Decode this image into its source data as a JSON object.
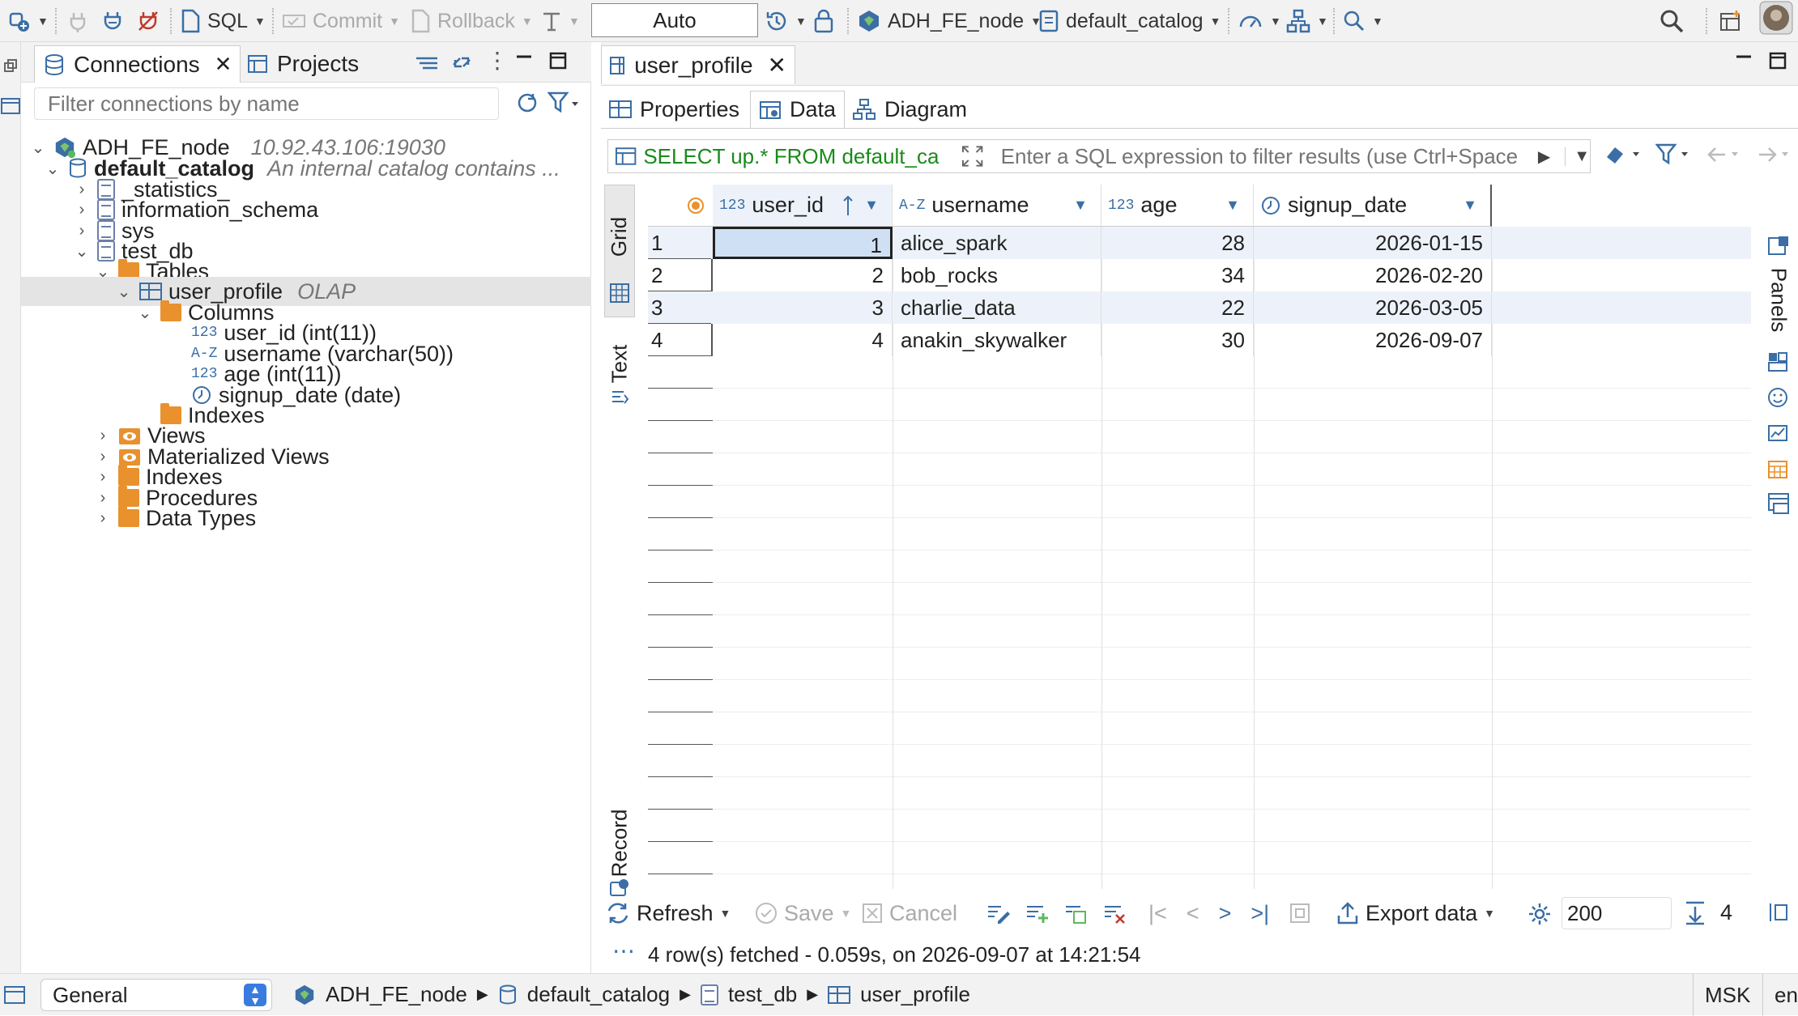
{
  "toolbar": {
    "sql_label": "SQL",
    "commit_label": "Commit",
    "rollback_label": "Rollback",
    "transaction_mode": "Auto",
    "connection": "ADH_FE_node",
    "catalog": "default_catalog"
  },
  "left": {
    "tab_connections": "Connections",
    "tab_projects": "Projects",
    "filter_placeholder": "Filter connections by name",
    "tree": {
      "connection": "ADH_FE_node",
      "connection_addr": "10.92.43.106:19030",
      "catalog": "default_catalog",
      "catalog_desc": "An internal catalog contains ...",
      "schema1": "_statistics_",
      "schema2": "information_schema",
      "schema3": "sys",
      "schema4": "test_db",
      "tables": "Tables",
      "table": "user_profile",
      "table_type": "OLAP",
      "columns": "Columns",
      "col1_tag": "123",
      "col1": "user_id (int(11))",
      "col2_tag": "A-Z",
      "col2": "username (varchar(50))",
      "col3_tag": "123",
      "col3": "age (int(11))",
      "col4": "signup_date (date)",
      "table_indexes": "Indexes",
      "views": "Views",
      "mviews": "Materialized Views",
      "indexes": "Indexes",
      "procedures": "Procedures",
      "datatypes": "Data Types"
    }
  },
  "editor": {
    "tab_title": "user_profile",
    "subtab_properties": "Properties",
    "subtab_data": "Data",
    "subtab_diagram": "Diagram",
    "sql_query": "SELECT up.* FROM default_ca",
    "filter_placeholder": "Enter a SQL expression to filter results (use Ctrl+Space",
    "vtab_grid": "Grid",
    "vtab_text": "Text",
    "vtab_record": "Record",
    "vtab_panels": "Panels"
  },
  "grid": {
    "columns": [
      {
        "tag": "123",
        "name": "user_id"
      },
      {
        "tag": "A-Z",
        "name": "username"
      },
      {
        "tag": "123",
        "name": "age"
      },
      {
        "tag": "",
        "name": "signup_date"
      }
    ],
    "rows": [
      {
        "n": "1",
        "user_id": "1",
        "username": "alice_spark",
        "age": "28",
        "signup_date": "2026-01-15"
      },
      {
        "n": "2",
        "user_id": "2",
        "username": "bob_rocks",
        "age": "34",
        "signup_date": "2026-02-20"
      },
      {
        "n": "3",
        "user_id": "3",
        "username": "charlie_data",
        "age": "22",
        "signup_date": "2026-03-05"
      },
      {
        "n": "4",
        "user_id": "4",
        "username": "anakin_skywalker",
        "age": "30",
        "signup_date": "2026-09-07"
      }
    ]
  },
  "bottom": {
    "refresh": "Refresh",
    "save": "Save",
    "cancel": "Cancel",
    "export": "Export data",
    "fetch_size": "200",
    "row_count": "4",
    "status_message": "4 row(s) fetched - 0.059s, on 2026-09-07 at 14:21:54"
  },
  "statusbar": {
    "mode": "General",
    "crumb_connection": "ADH_FE_node",
    "crumb_catalog": "default_catalog",
    "crumb_db": "test_db",
    "crumb_table": "user_profile",
    "timezone": "MSK",
    "locale": "en"
  }
}
